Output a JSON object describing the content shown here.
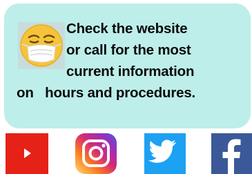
{
  "notice": {
    "lines": [
      "Check the website",
      "or call for the most",
      "current information",
      "on   hours and procedures."
    ],
    "emoji_icon": "face-with-medical-mask-icon",
    "background_color": "#bdeeea"
  },
  "social_links": [
    {
      "name": "youtube",
      "icon": "youtube-icon",
      "color": "#e62117"
    },
    {
      "name": "instagram",
      "icon": "instagram-icon",
      "color": "#c13584"
    },
    {
      "name": "twitter",
      "icon": "twitter-icon",
      "color": "#1da1f2"
    },
    {
      "name": "facebook",
      "icon": "facebook-icon",
      "color": "#3b5998"
    }
  ]
}
